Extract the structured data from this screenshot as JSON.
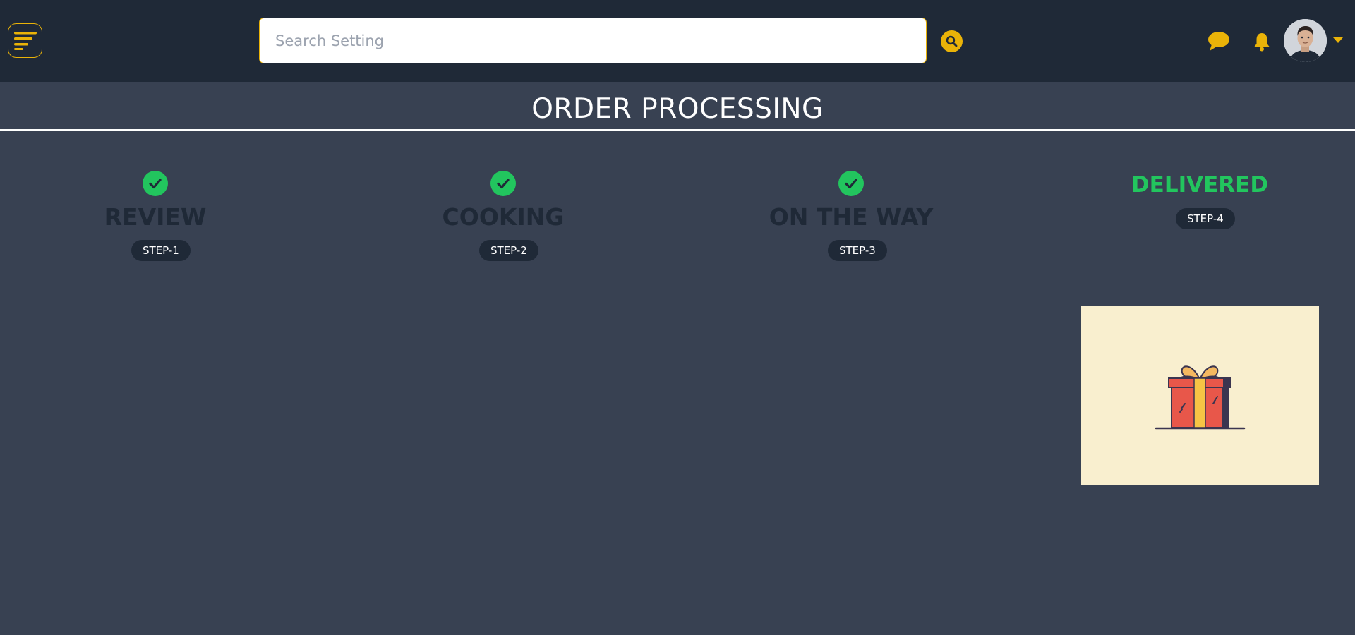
{
  "header": {
    "search": {
      "placeholder": "Search Setting",
      "value": ""
    },
    "icons": {
      "menu": "menu-lines-icon",
      "search": "search-icon",
      "chat": "chat-bubble-icon",
      "notifications": "bell-icon",
      "account_dropdown": "chevron-down-icon"
    }
  },
  "page": {
    "title": "ORDER PROCESSING"
  },
  "steps": [
    {
      "label": "REVIEW",
      "badge": "STEP-1",
      "completed": true
    },
    {
      "label": "COOKING",
      "badge": "STEP-2",
      "completed": true
    },
    {
      "label": "ON THE WAY",
      "badge": "STEP-3",
      "completed": true
    },
    {
      "label": "DELIVERED",
      "badge": "STEP-4",
      "completed": false,
      "current": true
    }
  ],
  "colors": {
    "accent": "#eab308",
    "header_bg": "#1f2937",
    "page_bg": "#384152",
    "success": "#22c55e",
    "card_bg": "#f9efcf"
  }
}
